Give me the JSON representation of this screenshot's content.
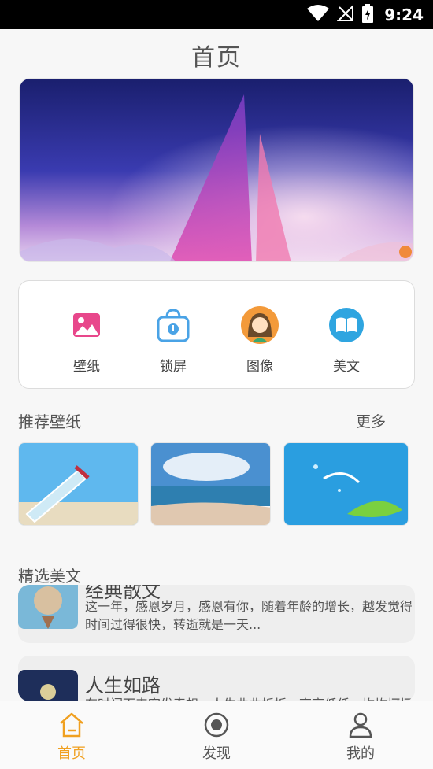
{
  "status_bar": {
    "time": "9:24",
    "icons": [
      "wifi-icon",
      "signal-off-icon",
      "battery-charging-icon"
    ]
  },
  "header": {
    "title": "首页"
  },
  "banner": {
    "image": "purple-night-sky-sailboat-illustration"
  },
  "quick_actions": [
    {
      "label": "壁纸",
      "icon": "picture-icon",
      "color": "#e8478b"
    },
    {
      "label": "锁屏",
      "icon": "lock-bag-icon",
      "color": "#4aa3e6"
    },
    {
      "label": "图像",
      "icon": "avatar-girl-icon",
      "color": "#f39a3a"
    },
    {
      "label": "美文",
      "icon": "book-icon",
      "color": "#2fa5e0"
    }
  ],
  "recommend": {
    "title": "推荐壁纸",
    "more": "更多",
    "thumbnails": [
      "bottle-on-beach",
      "ocean-beach-sky",
      "kiwi-water-splash"
    ]
  },
  "featured": {
    "title": "精选美文",
    "articles": [
      {
        "title": "经典散文",
        "text": "这一年，感恩岁月，感恩有你，随着年龄的增长，越发觉得时间过得很快，转逝就是一天..."
      },
      {
        "title": "人生如路",
        "text": "有时闲下来突发奇想，人生曲曲折折，高高低低，坎坎坷坷"
      }
    ]
  },
  "tab_bar": {
    "active": "首页",
    "active_color": "#f0a020",
    "tabs": [
      {
        "label": "首页",
        "icon": "home-icon"
      },
      {
        "label": "发现",
        "icon": "discover-icon"
      },
      {
        "label": "我的",
        "icon": "profile-icon"
      }
    ]
  }
}
